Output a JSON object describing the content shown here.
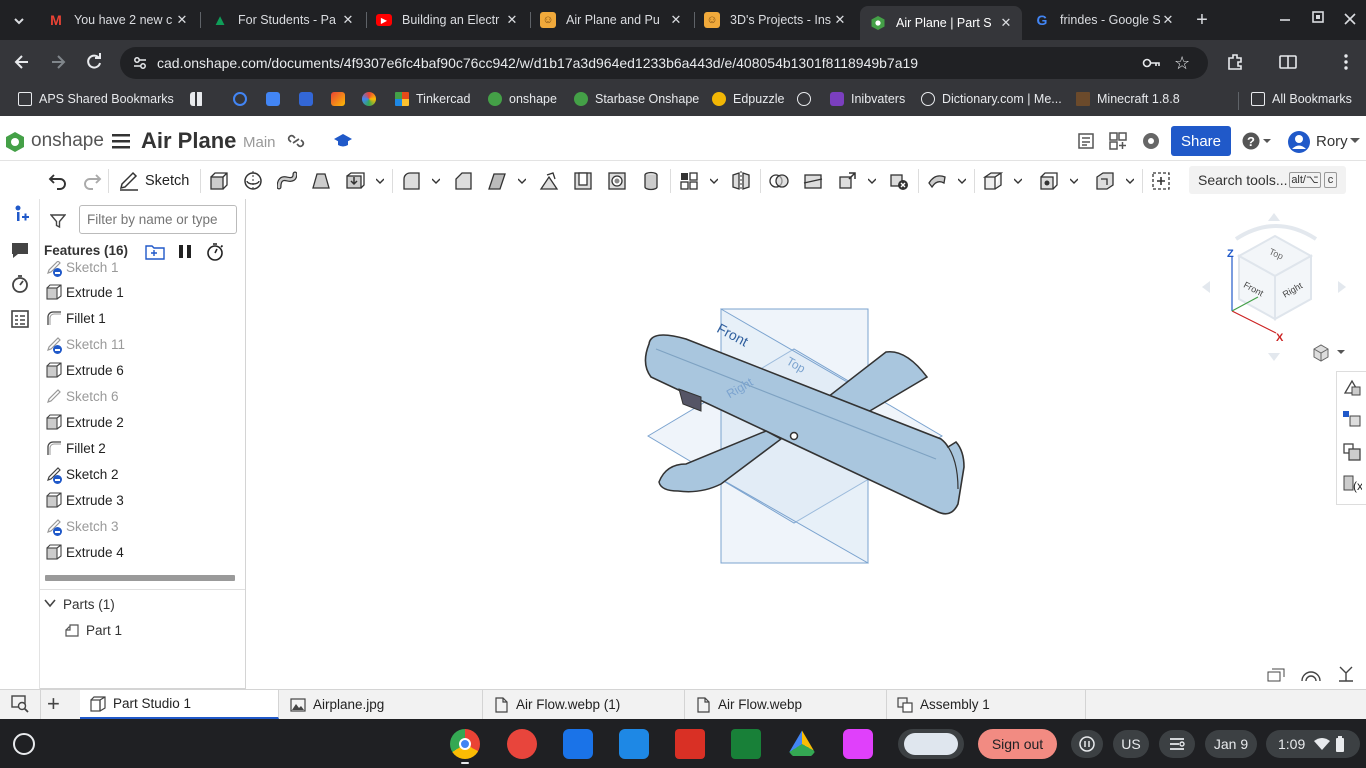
{
  "browser": {
    "tabs": [
      {
        "title": "You have 2 new c",
        "favicon": "gmail-icon",
        "color": "#ea4335"
      },
      {
        "title": "For Students - Pa",
        "favicon": "aps-icon",
        "color": "#0f9d58"
      },
      {
        "title": "Building an Electr",
        "favicon": "youtube-icon",
        "color": "#ff0000"
      },
      {
        "title": "Air Plane and Pu",
        "favicon": "instructables-icon",
        "color": "#f0a93b"
      },
      {
        "title": "3D's Projects - Ins",
        "favicon": "instructables-icon",
        "color": "#f0a93b"
      },
      {
        "title": "Air Plane | Part S",
        "favicon": "onshape-icon",
        "color": "#44a047",
        "active": true
      },
      {
        "title": "frindes - Google S",
        "favicon": "google-icon",
        "color": "#4285f4"
      }
    ],
    "url": "cad.onshape.com/documents/4f9307e6fc4baf90c76cc942/w/d1b17a3d964ed1233b6a443d/e/408054b1301f8118949b7a19",
    "bookmarks": [
      "APS Shared Bookmarks",
      "",
      "",
      "",
      "",
      "",
      "",
      "Tinkercad",
      "onshape",
      "Starbase Onshape",
      "Edpuzzle",
      "",
      "Inibvaters",
      "Dictionary.com | Me...",
      "Minecraft 1.8.8"
    ],
    "all_bookmarks": "All Bookmarks"
  },
  "onshape": {
    "logo": "onshape",
    "doc_title": "Air Plane",
    "branch": "Main",
    "share_label": "Share",
    "user": "Rory",
    "sketch_label": "Sketch",
    "search_tools": "Search tools...",
    "search_shortcut": "alt/⌥",
    "search_key": "c",
    "filter_placeholder": "Filter by name or type",
    "features_header": "Features (16)",
    "features": [
      {
        "name": "Sketch 1",
        "type": "sketch",
        "dim": true,
        "rollback": true
      },
      {
        "name": "Extrude 1",
        "type": "extrude"
      },
      {
        "name": "Fillet 1",
        "type": "fillet"
      },
      {
        "name": "Sketch 11",
        "type": "sketch",
        "dim": true,
        "rollback": true
      },
      {
        "name": "Extrude 6",
        "type": "extrude"
      },
      {
        "name": "Sketch 6",
        "type": "sketch",
        "dim": true
      },
      {
        "name": "Extrude 2",
        "type": "extrude"
      },
      {
        "name": "Fillet 2",
        "type": "fillet"
      },
      {
        "name": "Sketch 2",
        "type": "sketch",
        "rollback": true
      },
      {
        "name": "Extrude 3",
        "type": "extrude"
      },
      {
        "name": "Sketch 3",
        "type": "sketch",
        "dim": true,
        "rollback": true
      },
      {
        "name": "Extrude 4",
        "type": "extrude"
      }
    ],
    "parts_header": "Parts (1)",
    "parts": [
      "Part 1"
    ],
    "view_cube": {
      "top": "Top",
      "front": "Front",
      "right": "Right",
      "z": "Z",
      "x": "X"
    },
    "planes": {
      "front": "Front",
      "top": "Top",
      "right": "Right"
    },
    "bottom_tabs": [
      {
        "label": "Part Studio 1",
        "active": true,
        "icon": "part-studio-icon"
      },
      {
        "label": "Airplane.jpg",
        "icon": "image-icon"
      },
      {
        "label": "Air Flow.webp (1)",
        "icon": "file-icon"
      },
      {
        "label": "Air Flow.webp",
        "icon": "file-icon"
      },
      {
        "label": "Assembly 1",
        "icon": "assembly-icon"
      }
    ]
  },
  "shelf": {
    "sign_out": "Sign out",
    "ime": "US",
    "date": "Jan 9",
    "time": "1:09"
  },
  "colors": {
    "accent": "#2059c9",
    "part_fill": "#a9c6de",
    "plane_fill": "#dbe7f3"
  }
}
